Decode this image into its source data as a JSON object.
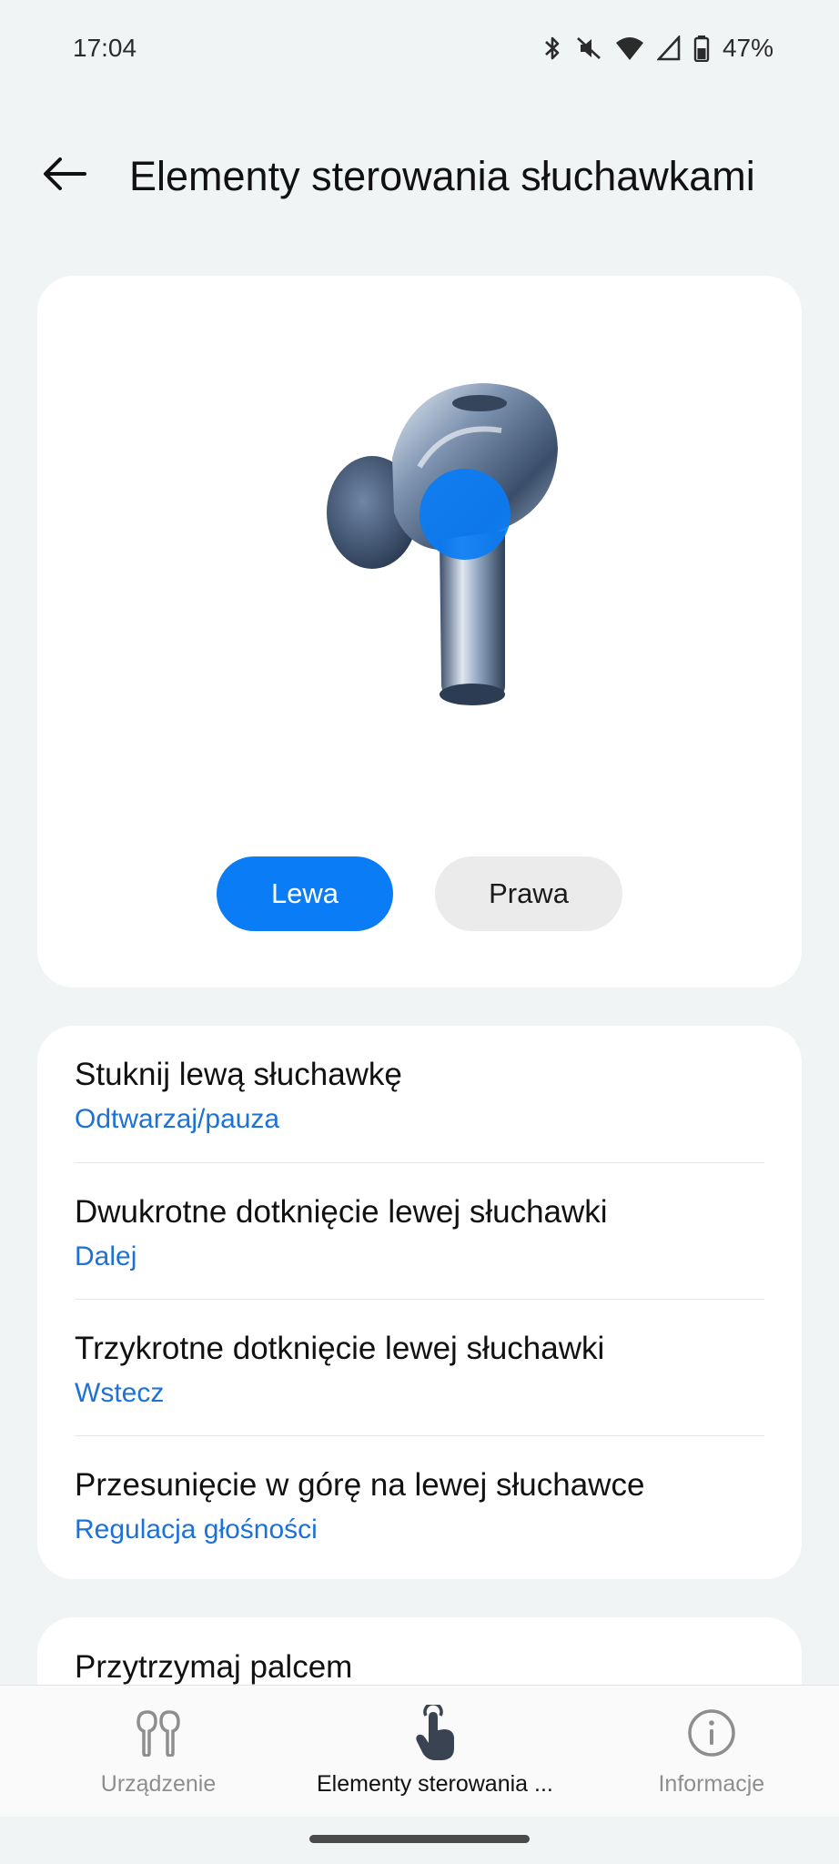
{
  "status_bar": {
    "time": "17:04",
    "battery": "47%",
    "icons": [
      "bluetooth-icon",
      "mute-icon",
      "wifi-icon",
      "signal-icon",
      "battery-icon"
    ]
  },
  "header": {
    "title": "Elementy sterowania słuchawkami",
    "back_icon": "arrow-left-icon"
  },
  "hero": {
    "image": "earbud-image",
    "toggle": {
      "left_label": "Lewa",
      "right_label": "Prawa",
      "selected": "Lewa"
    }
  },
  "controls": [
    {
      "title": "Stuknij lewą słuchawkę",
      "value": "Odtwarzaj/pauza"
    },
    {
      "title": "Dwukrotne dotknięcie lewej słuchawki",
      "value": "Dalej"
    },
    {
      "title": "Trzykrotne dotknięcie lewej słuchawki",
      "value": "Wstecz"
    },
    {
      "title": "Przesunięcie w górę na lewej słuchawce",
      "value": "Regulacja głośności"
    }
  ],
  "partial_section": {
    "title": "Przytrzymaj palcem"
  },
  "bottom_nav": [
    {
      "label": "Urządzenie",
      "icon": "earbuds-icon",
      "active": false
    },
    {
      "label": "Elementy sterowania ...",
      "icon": "touch-hand-icon",
      "active": true
    },
    {
      "label": "Informacje",
      "icon": "info-icon",
      "active": false
    }
  ],
  "colors": {
    "accent": "#0a7cf5",
    "link": "#1d72d6",
    "background": "#f1f4f5"
  }
}
